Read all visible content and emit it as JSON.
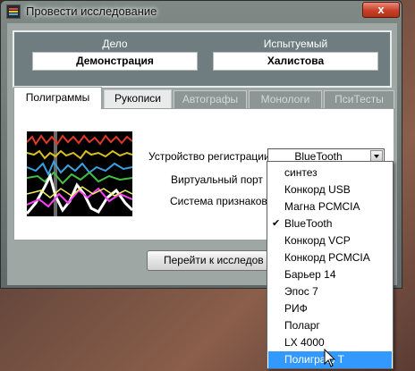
{
  "window": {
    "title": "Провести исследование",
    "close_label": "x"
  },
  "header": {
    "case_label": "Дело",
    "case_value": "Демонстрация",
    "subject_label": "Испытуемый",
    "subject_value": "Халистова"
  },
  "tabs": [
    "Полиграммы",
    "Рукописи",
    "Автографы",
    "Монологи",
    "ПсиТесты"
  ],
  "active_tab": "Полиграммы",
  "form": {
    "device_label": "Устройство регистрации",
    "device_value": "BlueTooth",
    "virtual_port_label": "Виртуальный порт",
    "features_label": "Система признаков"
  },
  "goto_button_label": "Перейти к исследов",
  "dropdown": {
    "options": [
      "синтез",
      "Конкорд USB",
      "Магна PCMCIA",
      "BlueTooth",
      "Конкорд VCP",
      "Конкорд PCMCIA",
      "Барьер 14",
      "Эпос 7",
      "РИФ",
      "Поларг",
      "LX 4000",
      "Полиграф Т"
    ],
    "checked": "BlueTooth",
    "highlighted": "Полиграф Т"
  },
  "colors": {
    "highlight": "#3399ff",
    "close_red": "#c9402a",
    "header_bg": "#6f7d80"
  }
}
